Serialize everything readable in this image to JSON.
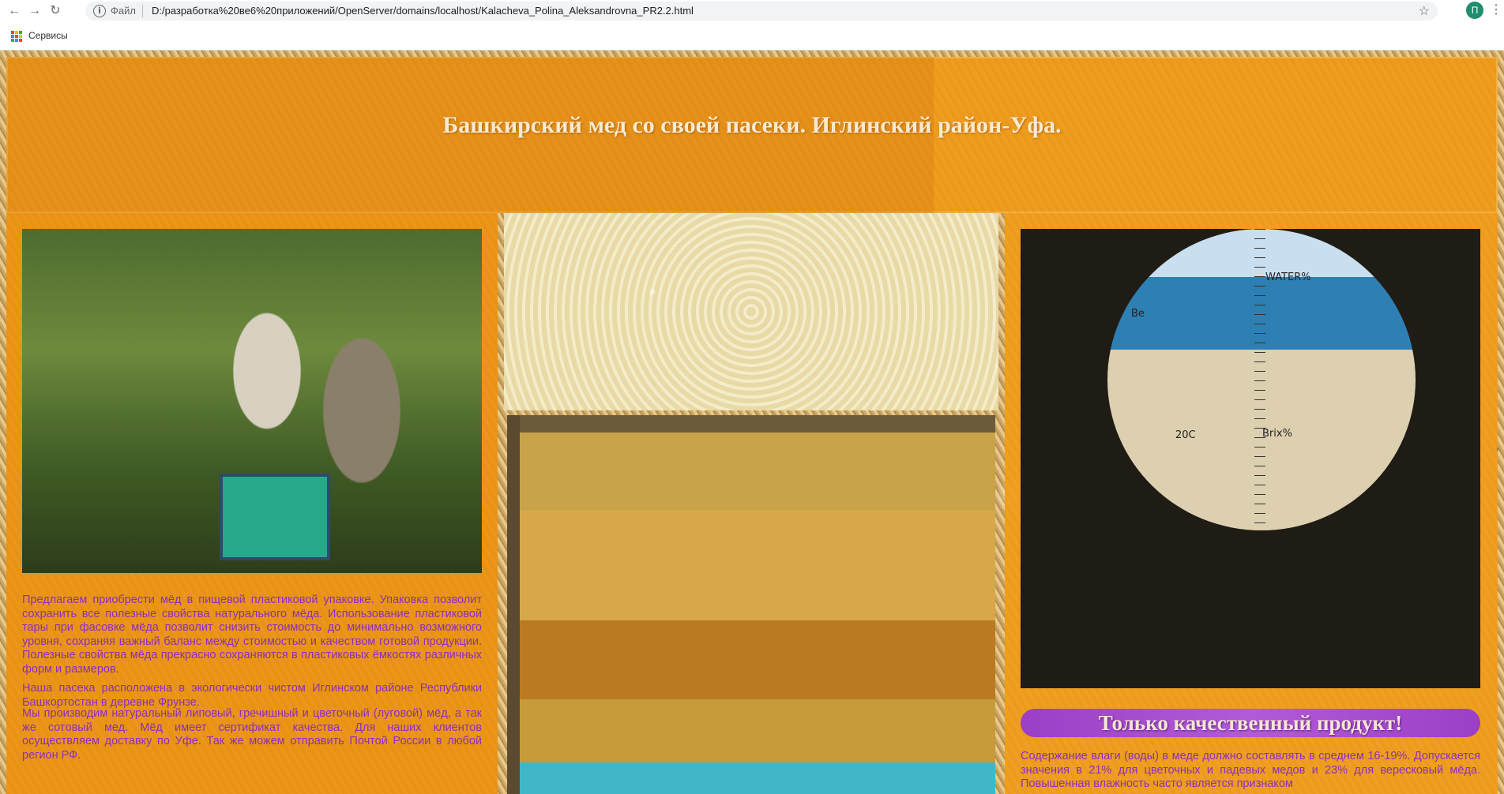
{
  "browser": {
    "scheme_label": "Файл",
    "url": "D:/разработка%20ве6%20приложений/OpenServer/domains/localhost/Kalacheva_Polina_Aleksandrovna_PR2.2.html",
    "profile_initial": "П",
    "bookmarks_label": "Сервисы"
  },
  "header": {
    "title": "Башкирский мед со своей пасеки. Иглинский район-Уфа."
  },
  "left": {
    "paragraph1": "Предлагаем приобрести мёд в пищевой пластиковой упаковке. Упаковка позволит сохранить все полезные свойства натурального мёда. Использование пластиковой тары при фасовке мёда позволит снизить стоимость до минимально возможного уровня, сохраняя важный баланс между стоимостью и качеством готовой продукции. Полезные свойства мёда прекрасно сохраняются в пластиковых ёмкостях различных форм и размеров.",
    "paragraph2": "Наша пасека расположена в экологически чистом Иглинском районе Республики Башкортостан в деревне Фрунзе.",
    "paragraph3": "Мы производим натуральный липовый, гречишный и цветочный (луговой) мёд, а так же сотовый мед. Мёд имеет сертификат качества. Для наших клиентов осуществляем доставку по Уфе. Так же можем отправить Почтой России в любой регион РФ."
  },
  "right": {
    "refractometer_labels": {
      "water": "WATER%",
      "be": "Be",
      "temp": "20C",
      "brix": "Brix%"
    },
    "quality_title": "Только качественный продукт!",
    "paragraph": "Содержание влаги (воды) в меде должно составлять в среднем 16-19%. Допускается значения в 21% для цветочных и падевых медов и 23% для вересковый мёда. Повышенная влажность часто является признаком"
  },
  "colors": {
    "accent_orange": "#f09814",
    "text_purple": "#8b2fbf",
    "banner_purple": "#9b3fc7"
  }
}
